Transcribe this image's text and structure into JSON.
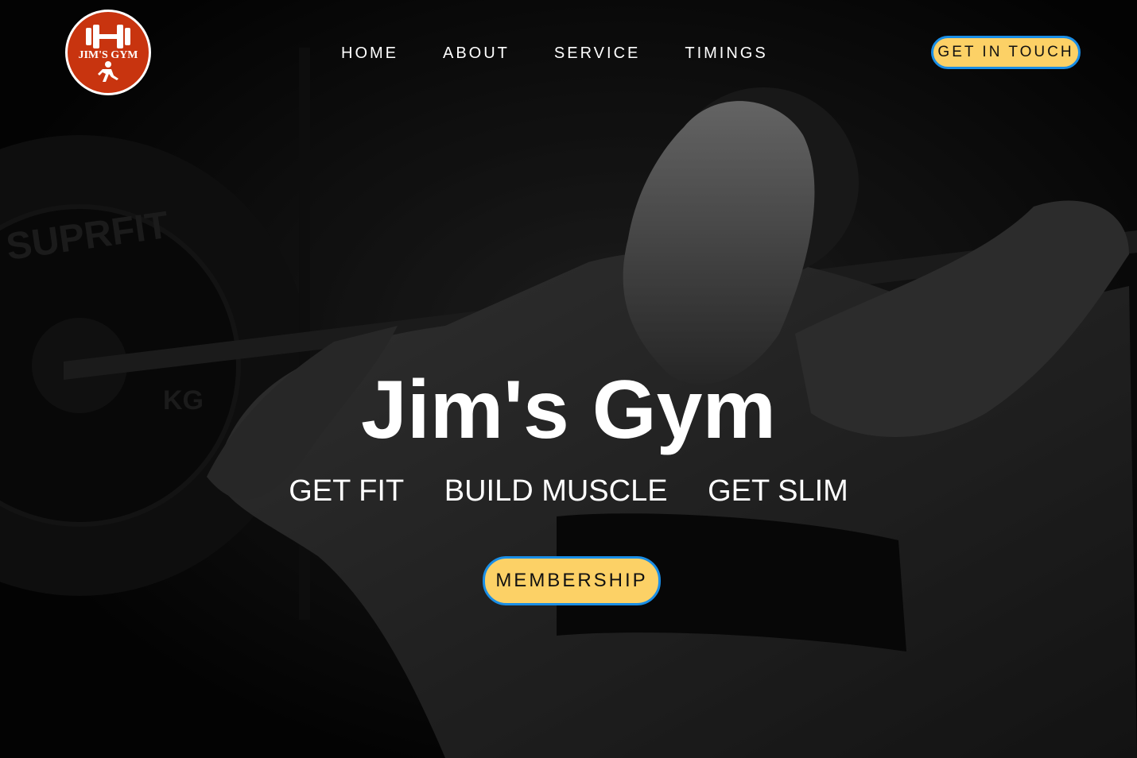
{
  "brand": {
    "logo_text": "JIM'S GYM"
  },
  "nav": {
    "items": [
      {
        "label": "HOME"
      },
      {
        "label": "ABOUT"
      },
      {
        "label": "SERVICE"
      },
      {
        "label": "TIMINGS"
      }
    ],
    "cta_label": "GET IN TOUCH"
  },
  "hero": {
    "title": "Jim's Gym",
    "taglines": [
      "GET FIT",
      "BUILD MUSCLE",
      "GET SLIM"
    ],
    "cta_label": "MEMBERSHIP",
    "plate_text": "SUPRFIT",
    "plate_unit": "KG"
  },
  "colors": {
    "accent": "#fcd166",
    "accent_border": "#1a8ee6",
    "logo_bg": "#c8340f"
  },
  "icons": {
    "logo": "dumbbell-runner-icon"
  }
}
